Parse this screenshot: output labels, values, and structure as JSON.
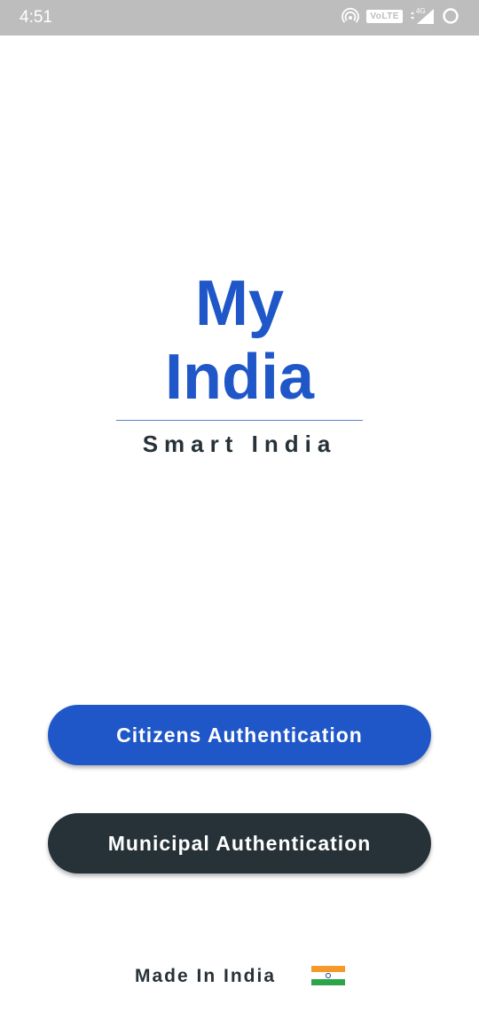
{
  "status_bar": {
    "time": "4:51",
    "volte": "VoLTE",
    "network": "4G"
  },
  "app": {
    "title_line1": "My",
    "title_line2": "India",
    "subtitle": "Smart India"
  },
  "buttons": {
    "citizens": "Citizens Authentication",
    "municipal": "Municipal Authentication"
  },
  "footer": {
    "made_in": "Made In India",
    "flag_icon": "india-flag-icon"
  },
  "colors": {
    "primary": "#1f57c9",
    "dark": "#263238",
    "status_bar": "#bdbdbd"
  }
}
